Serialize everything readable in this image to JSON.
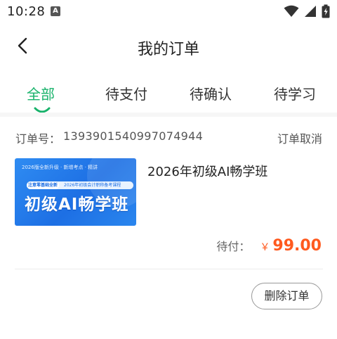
{
  "status_bar": {
    "time": "10:28",
    "notification_badge": "A",
    "icons": [
      "wifi-icon",
      "cellular-signal-icon",
      "battery-charging-icon"
    ]
  },
  "header": {
    "title": "我的订单",
    "back_icon": "chevron-left-icon"
  },
  "tabs": [
    {
      "label": "全部",
      "active": true
    },
    {
      "label": "待支付",
      "active": false
    },
    {
      "label": "待确认",
      "active": false
    },
    {
      "label": "待学习",
      "active": false
    }
  ],
  "colors": {
    "accent": "#17b26a",
    "price": "#ff5a1f",
    "thumb_blue": "#1d6fe4"
  },
  "order": {
    "number_label": "订单号：",
    "number": "1393901540997074944",
    "cancel_label": "订单取消",
    "course": {
      "name": "2026年初级AI畅学班",
      "thumbnail": {
        "top_text": "2026版全新升级 · 新增考点 · 精讲",
        "pill_left": "注意零基础全新",
        "pill_right": "2026年初级会计职称备考课程",
        "title": "初级AI畅学班"
      }
    },
    "price_label": "待付：",
    "currency": "￥",
    "price": "99.00",
    "delete_label": "删除订单"
  }
}
